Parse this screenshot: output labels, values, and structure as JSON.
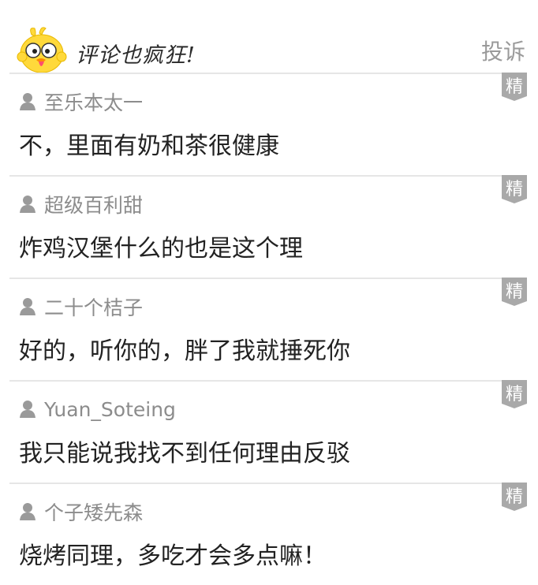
{
  "header": {
    "title": "评论也疯狂!",
    "report_label": "投诉"
  },
  "badge_label": "精",
  "comments": [
    {
      "user": "至乐本太一",
      "text": "不，里面有奶和茶很健康"
    },
    {
      "user": "超级百利甜",
      "text": "炸鸡汉堡什么的也是这个理"
    },
    {
      "user": "二十个桔子",
      "text": "好的，听你的，胖了我就捶死你"
    },
    {
      "user": "Yuan_Soteing",
      "text": "我只能说我找不到任何理由反驳"
    },
    {
      "user": "个子矮先森",
      "text": "烧烤同理，多吃才会多点嘛！"
    }
  ],
  "colors": {
    "badge": "#a9a9a9",
    "username": "#8c8c8c",
    "divider": "#e6e6e6",
    "mascot": "#ffd93b"
  }
}
